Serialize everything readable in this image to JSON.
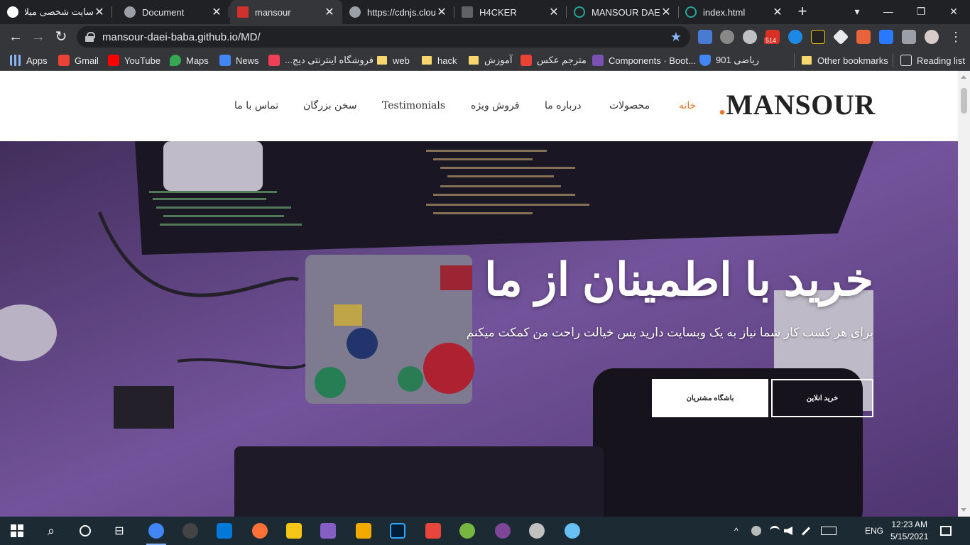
{
  "tabs": [
    {
      "title": "سایت شخصی میلاد",
      "favicon_color": "#ffffff"
    },
    {
      "title": "Document",
      "favicon_color": "#9aa0a6"
    },
    {
      "title": "mansour",
      "favicon_color": "#d0312d"
    },
    {
      "title": "https://cdnjs.cloudf",
      "favicon_color": "#9aa0a6"
    },
    {
      "title": "H4CKER",
      "favicon_color": "#5f6368"
    },
    {
      "title": "MANSOUR DAEI BA",
      "favicon_color": "#26a69a"
    },
    {
      "title": "index.html",
      "favicon_color": "#26a69a"
    }
  ],
  "active_tab_index": 2,
  "toolbar": {
    "url": "mansour-daei-baba.github.io/MD/",
    "back_icon": "←",
    "forward_icon": "→",
    "reload_icon": "↻",
    "star_icon": "★",
    "mail_badge": "514",
    "new_tab_icon": "+",
    "tab_close_icon": "✕",
    "tab_search_icon": "▾",
    "minimize_icon": "—",
    "restore_icon": "❐",
    "close_window_icon": "✕"
  },
  "bookmarks": [
    {
      "label": "Apps",
      "icon": "apps-grid-icon",
      "color": "#8ab4f8"
    },
    {
      "label": "Gmail",
      "icon": "gmail-icon",
      "color": "#ea4335"
    },
    {
      "label": "YouTube",
      "icon": "youtube-icon",
      "color": "#ff0000"
    },
    {
      "label": "Maps",
      "icon": "maps-icon",
      "color": "#34a853"
    },
    {
      "label": "News",
      "icon": "news-icon",
      "color": "#4285f4"
    },
    {
      "label": "فروشگاه اینترنتی دیج...",
      "icon": "digikala-icon",
      "color": "#ef4056"
    },
    {
      "label": "web",
      "icon": "folder-icon",
      "color": "#f5d76e"
    },
    {
      "label": "hack",
      "icon": "folder-icon",
      "color": "#f5d76e"
    },
    {
      "label": "آموزش",
      "icon": "folder-icon",
      "color": "#f5d76e"
    },
    {
      "label": "مترجم عکس",
      "icon": "translate-icon",
      "color": "#ea4335"
    },
    {
      "label": "Components · Boot...",
      "icon": "bootstrap-icon",
      "color": "#7952b3"
    },
    {
      "label": "ریاضی 901",
      "icon": "shield-icon",
      "color": "#4285f4"
    }
  ],
  "other_bookmarks": "Other bookmarks",
  "reading_list": "Reading list",
  "site": {
    "logo": "MANSOUR",
    "logo_dot": ".",
    "nav": [
      "خانه",
      "محصولات",
      "درباره ما",
      "فروش ویژه",
      "Testimonials",
      "سخن بزرگان",
      "تماس با ما"
    ],
    "active_nav_index": 0,
    "hero_title": "خرید با اطمینان از ما",
    "hero_subtitle": "برای هر کسب کار شما نیاز به یک وبسایت دارید پس خیالت راحت من کمکت میکنم",
    "btn_primary": "خرید انلاین",
    "btn_secondary": "باشگاه مشتریان"
  },
  "taskbar": {
    "time": "12:23 AM",
    "date": "5/15/2021",
    "language": "ENG",
    "apps": [
      {
        "name": "chrome",
        "color": "#4285f4"
      },
      {
        "name": "obs",
        "color": "#444444"
      },
      {
        "name": "vscode",
        "color": "#0078d7"
      },
      {
        "name": "firefox",
        "color": "#ff7139"
      },
      {
        "name": "explorer",
        "color": "#f5c518"
      },
      {
        "name": "visual-studio",
        "color": "#865fc5"
      },
      {
        "name": "box-app",
        "color": "#f2a900"
      },
      {
        "name": "photoshop",
        "color": "#31a8ff"
      },
      {
        "name": "paint-app",
        "color": "#e8453c"
      },
      {
        "name": "utorrent",
        "color": "#76b83f"
      },
      {
        "name": "tor",
        "color": "#7d4698"
      },
      {
        "name": "wamp",
        "color": "#c0c0c0"
      },
      {
        "name": "steam",
        "color": "#66c0f4"
      }
    ]
  }
}
